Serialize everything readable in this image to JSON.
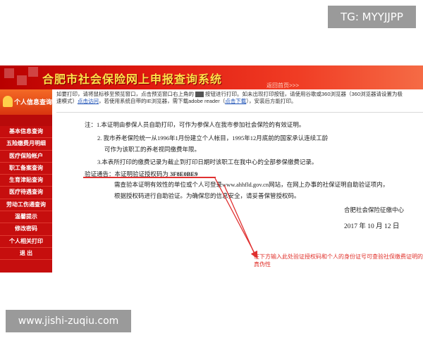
{
  "watermarks": {
    "top": "TG: MYYJJPP",
    "bottom": "www.jishi-zuqiu.com"
  },
  "header": {
    "title": "合肥市社会保险网上申报查询系统",
    "back_home": "返回首页>>>"
  },
  "sidebar": {
    "head": "个人信息查询",
    "items": [
      {
        "label": "基本信息查询"
      },
      {
        "label": "五险缴费月明细"
      },
      {
        "label": "医疗保险帐户"
      },
      {
        "label": "职工备案查询"
      },
      {
        "label": "生育津贴查询"
      },
      {
        "label": "医疗待遇查询"
      },
      {
        "label": "劳动工伤通查询"
      },
      {
        "label": "温馨提示"
      },
      {
        "label": "修改密码"
      },
      {
        "label": "个人相关打印"
      },
      {
        "label": "退 出"
      }
    ]
  },
  "print_notice": {
    "line1_a": "如要打印，请将鼠标移至预览窗口，点击预览窗口右上角的",
    "line1_b": "按钮进行打印。如未出现打印按钮，请使用谷歌或360浏览器（360浏览器请设置为极",
    "line2_a": "速模式）",
    "link1": "点击访问",
    "line2_b": "，若使用系统自带的IE浏览器，需下载adobe reader（",
    "link2": "点击下载",
    "line2_c": "），安装后方能打印。"
  },
  "document": {
    "note1": "注：1.本证明由参保人员自助打印，可作为参保人在我市参加社会保险的有效证明。",
    "note2": "2. 我市养老保险统一从1996年1月份建立个人帐目，1995年12月底前的国家承认连续工龄",
    "note2b": "可作为该职工的养老视同缴费年限。",
    "note3": "3.本表所打印的缴费记录为截止到打印日期时该职工在我中心的全部参保缴费记录。",
    "verify_label": "验证通告：本证明验证授权码为",
    "verify_code": "3F8E0BE9",
    "body1": "需查验本证明有效性的单位或个人可登录www.ahhfld.gov.cn网站，在网上办事的社保证明自助验证项内，",
    "body2": "根据授权码进行自助验证。为确保您的信息安全，请妥善保管授权码。",
    "org": "合肥社会保险征缴中心",
    "date": "2017  年  10  月  12  日"
  },
  "annotation": "在下方输入此处验证授权码和个人的身份证号可查验社保缴费证明的真伪性",
  "colors": {
    "banner": "#e01a10",
    "sidebar": "#c60e0e",
    "annotation": "#e0302a",
    "title": "#ffe24a"
  }
}
